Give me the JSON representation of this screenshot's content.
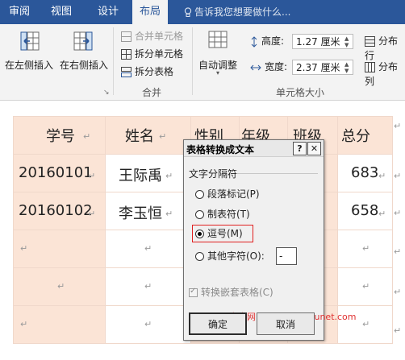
{
  "tabs": [
    {
      "label": "审阅",
      "active": false
    },
    {
      "label": "视图",
      "active": false
    },
    {
      "label": "设计",
      "active": false
    },
    {
      "label": "布局",
      "active": true
    }
  ],
  "tell_me": {
    "text": "告诉我您想要做什么...",
    "icon": "lightbulb-icon"
  },
  "ribbon": {
    "insert_left": "在左侧插入",
    "insert_right": "在右侧插入",
    "merge": {
      "merge_cells": "合并单元格",
      "split_cells": "拆分单元格",
      "split_table": "拆分表格",
      "group_label": "合并"
    },
    "autofit": "自动调整",
    "cell_size": {
      "height_label": "高度:",
      "height_value": "1.27 厘米",
      "width_label": "宽度:",
      "width_value": "2.37 厘米",
      "group_label": "单元格大小"
    },
    "distribute_rows": "分布行",
    "distribute_cols": "分布列"
  },
  "table": {
    "headers": [
      "学号",
      "姓名",
      "性别",
      "年级",
      "班级",
      "总分"
    ],
    "rows": [
      [
        "20160101",
        "王际禹",
        "",
        "",
        "",
        "683"
      ],
      [
        "20160102",
        "李玉恒",
        "",
        "",
        "",
        "658"
      ],
      [
        "",
        "",
        "",
        "",
        "",
        ""
      ],
      [
        "",
        "",
        "",
        "",
        "",
        ""
      ],
      [
        "",
        "",
        "",
        "",
        "",
        ""
      ]
    ],
    "mark": "↵"
  },
  "dialog": {
    "title": "表格转换成文本",
    "help": "?",
    "close": "✕",
    "section": "文字分隔符",
    "options": [
      {
        "label": "段落标记(P)",
        "checked": false
      },
      {
        "label": "制表符(T)",
        "checked": false
      },
      {
        "label": "逗号(M)",
        "checked": true
      },
      {
        "label": "其他字符(O):",
        "checked": false
      }
    ],
    "other_value": "-",
    "nested_label": "转换嵌套表格(C)",
    "ok": "确定",
    "cancel": "取消",
    "watermark": "亮术网 www.liangshunet.com"
  },
  "colors": {
    "accent": "#2b579a",
    "header_fill": "#fbe4d6",
    "highlight": "#e02020"
  }
}
